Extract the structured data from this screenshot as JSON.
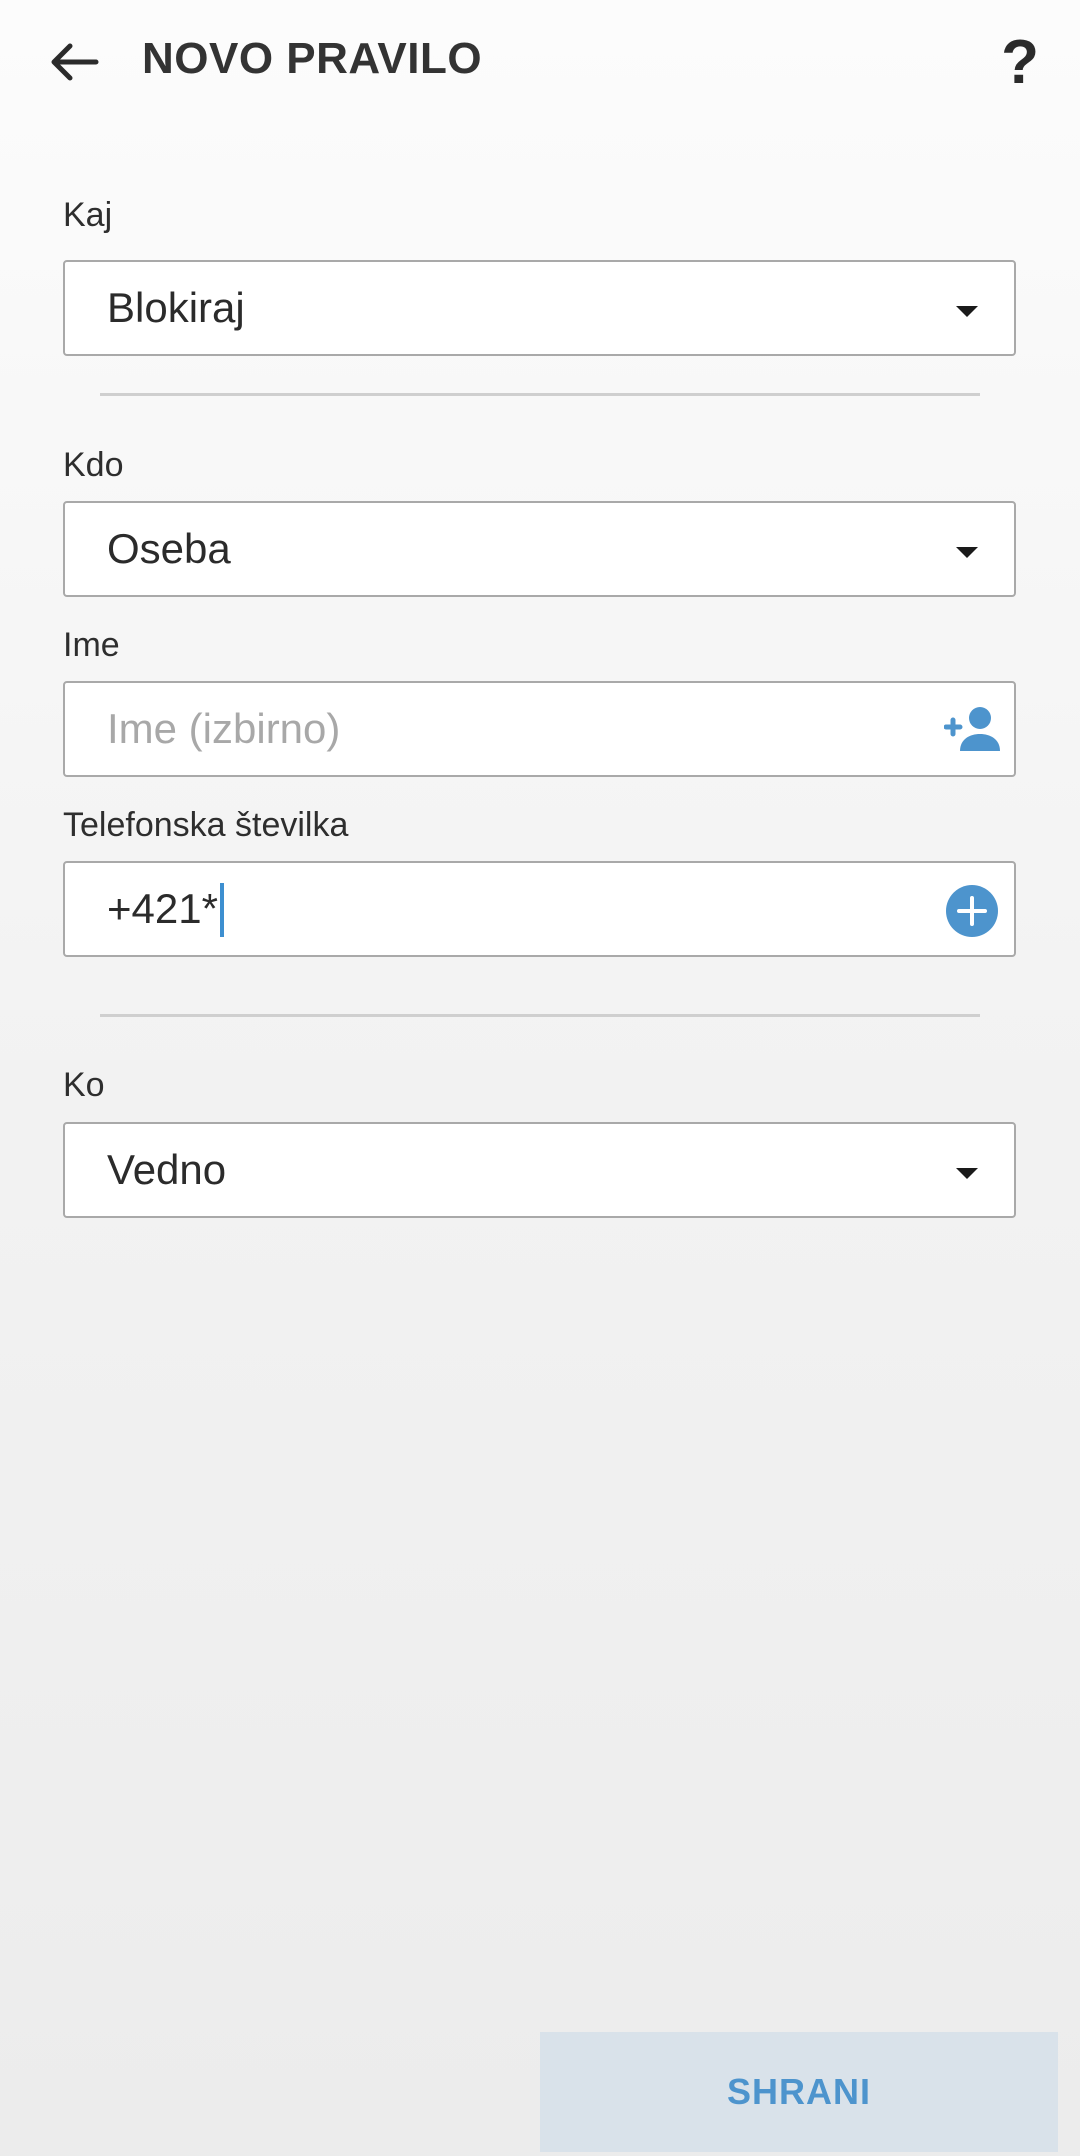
{
  "app_bar": {
    "title": "NOVO PRAVILO",
    "back_icon": "arrow-left-icon",
    "help_label": "?"
  },
  "form": {
    "kaj": {
      "label": "Kaj",
      "value": "Blokiraj"
    },
    "kdo": {
      "label": "Kdo",
      "value": "Oseba"
    },
    "ime": {
      "label": "Ime",
      "value": "",
      "placeholder": "Ime (izbirno)",
      "icon": "add-person-icon"
    },
    "telefon": {
      "label": "Telefonska številka",
      "value": "+421*",
      "icon": "add-circle-icon"
    },
    "ko": {
      "label": "Ko",
      "value": "Vedno"
    }
  },
  "save_label": "SHRANI",
  "colors": {
    "accent": "#4d94cd",
    "save_bg": "#d9e2ea",
    "field_border": "#a9a9a9"
  }
}
